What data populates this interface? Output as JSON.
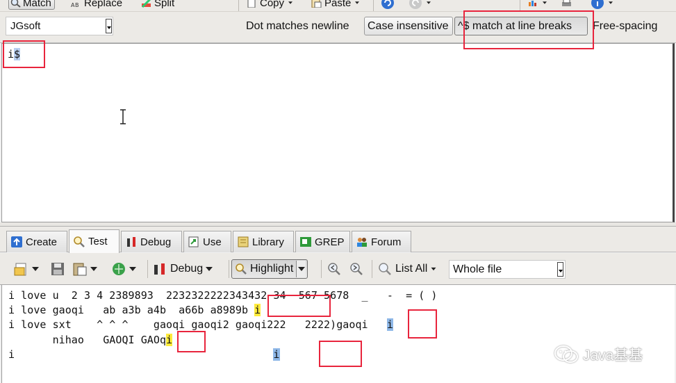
{
  "toolbar": {
    "match_label": "Match",
    "replace_label": "Replace",
    "split_label": "Split",
    "copy_label": "Copy",
    "paste_label": "Paste"
  },
  "options": {
    "flavor": "JGsoft",
    "dot_matches_newline": "Dot matches newline",
    "case_insensitive": "Case insensitive",
    "caret_dollar": "^$ match at line breaks",
    "free_spacing": "Free-spacing"
  },
  "regex": {
    "prefix": "i",
    "selected": "$"
  },
  "tabs": [
    {
      "label": "Create"
    },
    {
      "label": "Test"
    },
    {
      "label": "Debug"
    },
    {
      "label": "Use"
    },
    {
      "label": "Library"
    },
    {
      "label": "GREP"
    },
    {
      "label": "Forum"
    }
  ],
  "test_toolbar": {
    "debug_label": "Debug",
    "highlight_label": "Highlight",
    "list_all_label": "List All",
    "scope": "Whole file"
  },
  "subject": {
    "line1": "i love u  2 3 4 2389893  2232322222343432 34  567 5678  _   -  = ( )",
    "line2_pre": "i love gaoqi   ab a3b a4b  a66b a8989b ",
    "line2_match": "i",
    "line3_pre": "i love sxt    ^ ^ ^    gaoqi gaoqi2 gaoqi222   2222)gaoqi   ",
    "line3_match": "i",
    "line4_pre": "       nihao   GAOQI GAOq",
    "line4_match": "i",
    "line5_pre": "i                                         ",
    "line5_match": "i"
  },
  "watermark": "Java基基"
}
